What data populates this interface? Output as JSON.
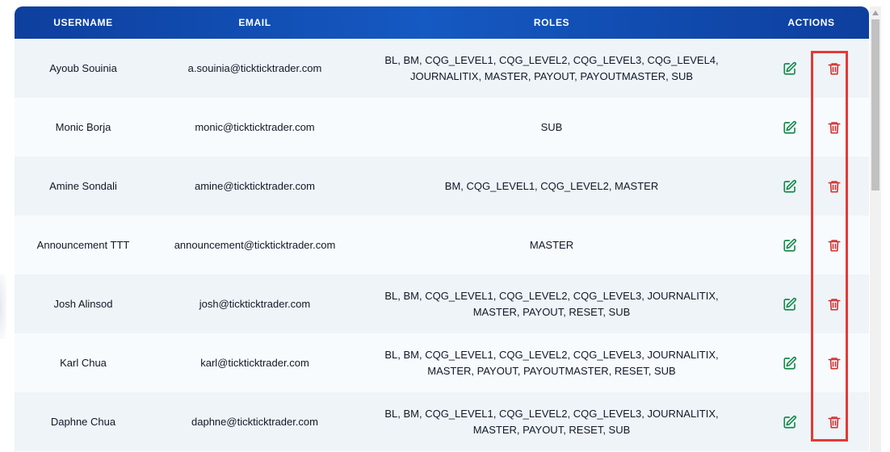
{
  "table": {
    "headers": {
      "username": "USERNAME",
      "email": "EMAIL",
      "roles": "ROLES",
      "actions": "ACTIONS"
    },
    "rows": [
      {
        "username": "Ayoub Souinia",
        "email": "a.souinia@tickticktrader.com",
        "roles_line1": "BL, BM, CQG_LEVEL1, CQG_LEVEL2, CQG_LEVEL3, CQG_LEVEL4,",
        "roles_line2": "JOURNALITIX, MASTER, PAYOUT, PAYOUTMASTER, SUB"
      },
      {
        "username": "Monic Borja",
        "email": "monic@tickticktrader.com",
        "roles_line1": "SUB",
        "roles_line2": ""
      },
      {
        "username": "Amine Sondali",
        "email": "amine@tickticktrader.com",
        "roles_line1": "BM, CQG_LEVEL1, CQG_LEVEL2, MASTER",
        "roles_line2": ""
      },
      {
        "username": "Announcement TTT",
        "email": "announcement@tickticktrader.com",
        "roles_line1": "MASTER",
        "roles_line2": ""
      },
      {
        "username": "Josh Alinsod",
        "email": "josh@tickticktrader.com",
        "roles_line1": "BL, BM, CQG_LEVEL1, CQG_LEVEL2, CQG_LEVEL3, JOURNALITIX,",
        "roles_line2": "MASTER, PAYOUT, RESET, SUB"
      },
      {
        "username": "Karl Chua",
        "email": "karl@tickticktrader.com",
        "roles_line1": "BL, BM, CQG_LEVEL1, CQG_LEVEL2, CQG_LEVEL3, JOURNALITIX,",
        "roles_line2": "MASTER, PAYOUT, PAYOUTMASTER, RESET, SUB"
      },
      {
        "username": "Daphne Chua",
        "email": "daphne@tickticktrader.com",
        "roles_line1": "BL, BM, CQG_LEVEL1, CQG_LEVEL2, CQG_LEVEL3, JOURNALITIX,",
        "roles_line2": "MASTER, PAYOUT, RESET, SUB"
      }
    ]
  },
  "icons": {
    "edit": "edit-icon",
    "delete": "trash-icon",
    "scroll_up": "scroll-up-arrow-icon"
  },
  "colors": {
    "header_start": "#0d3f9e",
    "header_mid": "#1559c2",
    "row_odd": "#eef4f8",
    "row_even": "#f7fbfe",
    "edit_icon": "#168a4a",
    "delete_icon": "#d32f2f",
    "highlight": "#e53935"
  }
}
